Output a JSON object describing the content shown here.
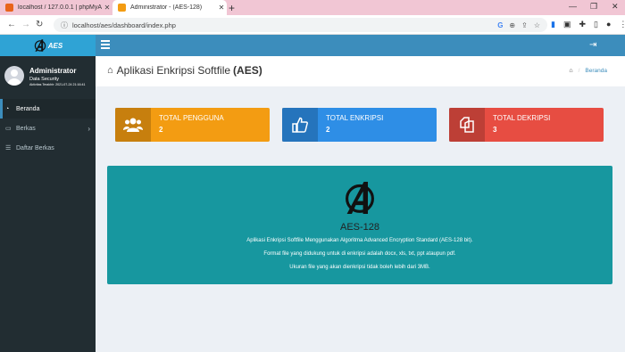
{
  "browser": {
    "tabs": [
      {
        "title": "localhost / 127.0.0.1 | phpMyAdmin",
        "favicon_color": "#e8641b"
      },
      {
        "title": "Administrator - (AES-128)",
        "favicon_color": "#f39c12"
      }
    ],
    "url": "localhost/aes/dashboard/index.php"
  },
  "header": {
    "logo_text": "AES"
  },
  "sidebar": {
    "user": {
      "name": "Administrator",
      "role": "Data Security",
      "activity": "Aktivitas Terakhir: 2021-07-24 21:16:41"
    },
    "items": [
      {
        "label": "Beranda",
        "icon": "dashboard-icon",
        "active": true
      },
      {
        "label": "Berkas",
        "icon": "file-icon",
        "has_children": true
      },
      {
        "label": "Daftar Berkas",
        "icon": "list-icon"
      }
    ]
  },
  "content": {
    "title": "Aplikasi Enkripsi Softfile",
    "title_bold": "(AES)",
    "breadcrumb": "Beranda"
  },
  "stats": [
    {
      "label": "TOTAL PENGGUNA",
      "value": "2",
      "color": "#f39c12",
      "icon": "users-icon"
    },
    {
      "label": "TOTAL ENKRIPSI",
      "value": "2",
      "color": "#2e8ee6",
      "icon": "thumbs-up-icon"
    },
    {
      "label": "TOTAL DEKRIPSI",
      "value": "3",
      "color": "#e74d42",
      "icon": "copy-icon"
    }
  ],
  "info_panel": {
    "title": "AES-128",
    "lines": [
      "Aplikasi Enkripsi Softfile Menggunakan Algoritma Advanced Encryption Standard (AES-128 bit).",
      "Format file yang didukung untuk di enkripsi adalah docx, xls, txt, ppt ataupun pdf.",
      "Ukuran file yang akan dienkripsi tidak boleh lebih dari 3MB."
    ],
    "color": "#17979f"
  }
}
